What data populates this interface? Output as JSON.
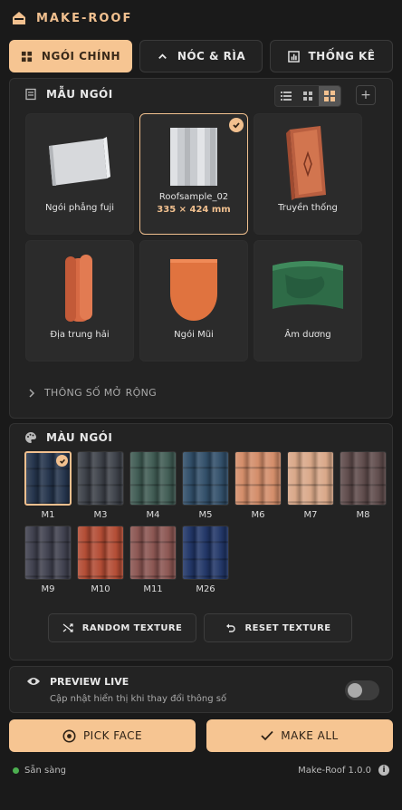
{
  "app": {
    "title": "MAKE-ROOF"
  },
  "tabs": [
    {
      "label": "NGÓI CHÍNH",
      "icon": "grid-icon",
      "active": true
    },
    {
      "label": "NÓC & RÌA",
      "icon": "chevron-up-icon",
      "active": false
    },
    {
      "label": "THỐNG KÊ",
      "icon": "chart-icon",
      "active": false
    }
  ],
  "tiles": {
    "title": "MẪU NGÓI",
    "view_modes": [
      "list-icon",
      "grid-small-icon",
      "grid-large-icon"
    ],
    "items": [
      {
        "name": "Ngói phẳng fuji",
        "selected": false
      },
      {
        "name": "Roofsample_02",
        "dims": "335 × 424 mm",
        "selected": true
      },
      {
        "name": "Truyền thống",
        "selected": false
      },
      {
        "name": "Địa trung hải",
        "selected": false
      },
      {
        "name": "Ngói Mũi",
        "selected": false
      },
      {
        "name": "Âm dương",
        "selected": false
      }
    ],
    "expander": "THÔNG SỐ MỞ RỘNG"
  },
  "colors": {
    "title": "MÀU NGÓI",
    "swatches": [
      {
        "code": "M1",
        "color": "#22324a",
        "selected": true
      },
      {
        "code": "M3",
        "color": "#3b3f47"
      },
      {
        "code": "M4",
        "color": "#3e5a52"
      },
      {
        "code": "M5",
        "color": "#2f4d68"
      },
      {
        "code": "M6",
        "color": "#d38c68"
      },
      {
        "code": "M7",
        "color": "#d9a787"
      },
      {
        "code": "M8",
        "color": "#5e4a4a"
      },
      {
        "code": "M9",
        "color": "#3e3f4d"
      },
      {
        "code": "M10",
        "color": "#b24a32"
      },
      {
        "code": "M11",
        "color": "#8a5450"
      },
      {
        "code": "M26",
        "color": "#1f3466"
      }
    ],
    "random_label": "RANDOM TEXTURE",
    "reset_label": "RESET TEXTURE"
  },
  "preview": {
    "title": "PREVIEW LIVE",
    "subtitle": "Cập nhật hiển thị khi thay đổi thông số",
    "enabled": false
  },
  "actions": {
    "pick_face": "PICK FACE",
    "make_all": "MAKE ALL"
  },
  "status": {
    "text": "Sẵn sàng",
    "version": "Make-Roof 1.0.0"
  },
  "accent": "#f6c592"
}
